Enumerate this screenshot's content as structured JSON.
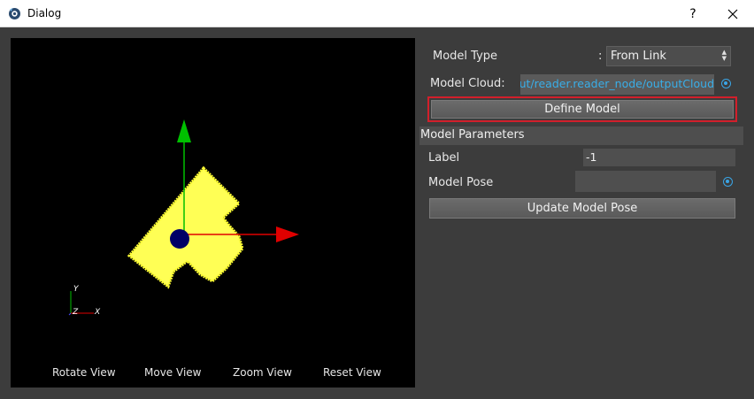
{
  "window": {
    "title": "Dialog",
    "help_label": "?"
  },
  "viewport": {
    "buttons": [
      "Rotate View",
      "Move View",
      "Zoom View",
      "Reset View"
    ],
    "axis_labels": {
      "y": "Y",
      "z": "Z",
      "x": "X"
    },
    "colors": {
      "model": "#ffff55",
      "x_axis": "#e00000",
      "y_axis": "#00c000",
      "origin": "#000066"
    }
  },
  "panel": {
    "model_type_label": "Model Type",
    "model_type_sep": ":",
    "model_type_value": "From Link",
    "model_cloud_label": "Model Cloud:",
    "model_cloud_value": "Out/reader.reader_node/outputCloud",
    "define_model_label": "Define Model",
    "params_header": "Model Parameters",
    "label_label": "Label",
    "label_value": "-1",
    "model_pose_label": "Model Pose",
    "model_pose_value": "",
    "update_pose_label": "Update Model Pose"
  },
  "colors": {
    "accent": "#3aa5e6",
    "highlight": "#d21f2b"
  }
}
